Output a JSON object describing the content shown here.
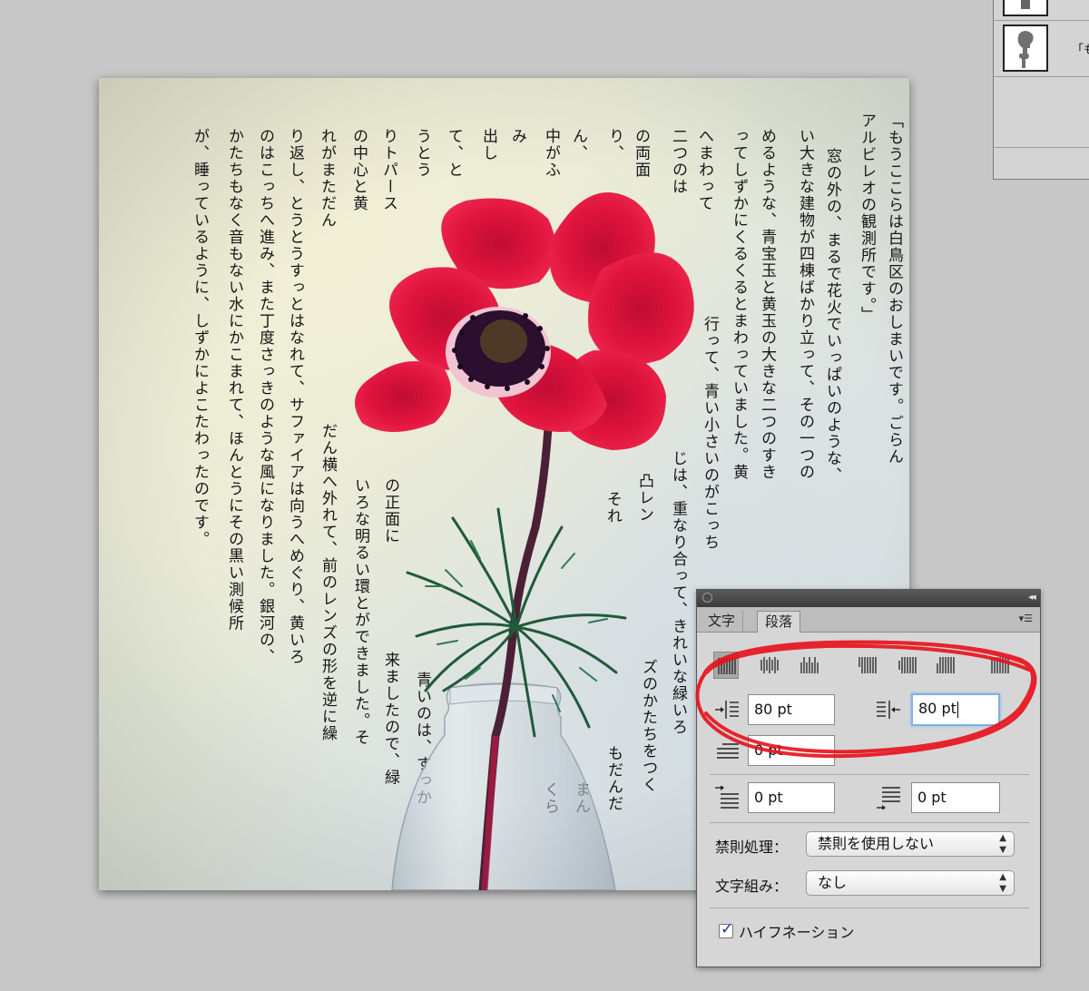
{
  "layers_panel": {
    "rows": [
      {
        "name": ""
      },
      {
        "name": "「も"
      }
    ]
  },
  "document": {
    "columns": [
      "「もうここらは白鳥区のおしまいです。ごらん",
      "アルビレオの観測所です。」",
      "窓の外の、まるで花火でいっぱいのような、",
      "い大きな建物が四棟ばかり立って、その一つの",
      "めるような、青宝玉と黄玉の大きな二つのすき",
      "ってしずかにくるくるとまわっていました。黄",
      "へまわって",
      "二つのは",
      "の両面",
      "り、",
      "ん、",
      "中がふ",
      "み",
      "出し",
      "て、と",
      "うとう",
      "りトパース",
      "の中心と黄",
      "れがまただん",
      "り返し、とうとうすっとはなれて、サファイアは向うへめぐり、黄いろ",
      "のはこっちへ進み、また丁度さっきのような風になりました。銀河の、",
      "かたちもなく音もない水にかこまれて、ほんとうにその黒い測候所",
      "が、睡っているように、しずかによこたわったのです。",
      "行って、青い小さいのがこっち",
      "じは、重なり合って、きれいな緑いろ",
      "ズのかたちをつく",
      "凸レン",
      "それ",
      "もだんだ",
      "まん",
      "くら",
      "青いのは、すっか",
      "来ましたので、緑",
      "の正面に",
      "いろな明るい環とができました。そ",
      "だん横へ外れて、前のレンズの形を逆に繰"
    ]
  },
  "paragraph_panel": {
    "tabs": [
      "文字",
      "段落"
    ],
    "active_tab": "段落",
    "alignment_active": "left",
    "left_indent": "80 pt",
    "right_indent": "80 pt",
    "first_line_indent": "0 pt",
    "space_before": "0 pt",
    "space_after": "0 pt",
    "kinsoku_label": "禁則処理：",
    "kinsoku_value": "禁則を使用しない",
    "mojikumi_label": "文字組み：",
    "mojikumi_value": "なし",
    "hyphenation_label": "ハイフネーション",
    "hyphenation_checked": true
  },
  "colors": {
    "annotation": "#e8101a",
    "petal": "#e0143c",
    "focus": "#7fb0e6"
  }
}
